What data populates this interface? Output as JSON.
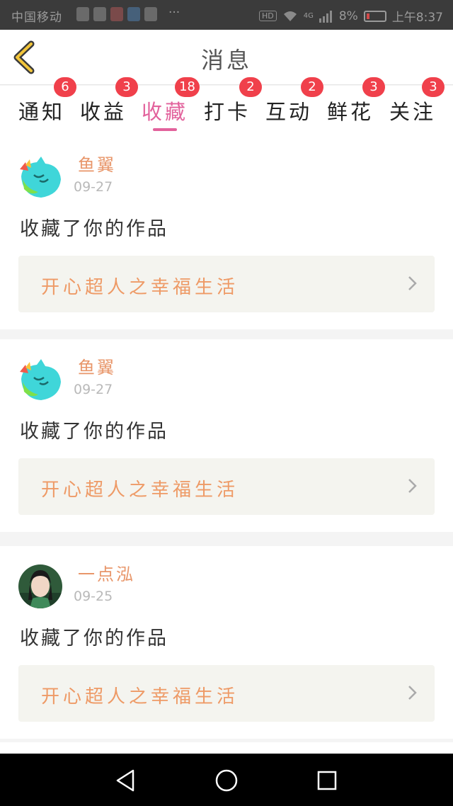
{
  "status_bar": {
    "carrier": "中国移动",
    "more": "···",
    "network": "4G",
    "hd": "HD",
    "battery": "8%",
    "time": "上午8:37"
  },
  "header": {
    "title": "消息",
    "back_icon": "chevron-left-icon"
  },
  "tabs": [
    {
      "label": "通知",
      "badge": "6",
      "active": false
    },
    {
      "label": "收益",
      "badge": "3",
      "active": false
    },
    {
      "label": "收藏",
      "badge": "18",
      "active": true
    },
    {
      "label": "打卡",
      "badge": "2",
      "active": false
    },
    {
      "label": "互动",
      "badge": "2",
      "active": false
    },
    {
      "label": "鲜花",
      "badge": "3",
      "active": false
    },
    {
      "label": "关注",
      "badge": "3",
      "active": false
    }
  ],
  "messages": [
    {
      "user": "鱼翼",
      "date": "09-27",
      "text": "收藏了你的作品",
      "work": "开心超人之幸福生活",
      "avatar": "cartoon-avatar"
    },
    {
      "user": "鱼翼",
      "date": "09-27",
      "text": "收藏了你的作品",
      "work": "开心超人之幸福生活",
      "avatar": "cartoon-avatar"
    },
    {
      "user": "一点泓",
      "date": "09-25",
      "text": "收藏了你的作品",
      "work": "开心超人之幸福生活",
      "avatar": "photo-avatar"
    }
  ],
  "colors": {
    "accent": "#e2629c",
    "badge": "#f0404b",
    "username": "#e8966a",
    "work_title": "#ee9a66",
    "work_bg": "#f4f4ef"
  },
  "nav_bar": {
    "back": "triangle-back-icon",
    "home": "circle-home-icon",
    "recents": "square-recents-icon"
  }
}
